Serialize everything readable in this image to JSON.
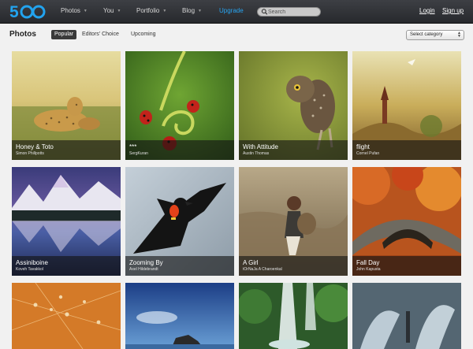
{
  "nav": {
    "logo_text": "500",
    "items": [
      {
        "label": "Photos"
      },
      {
        "label": "You"
      },
      {
        "label": "Portfolio"
      },
      {
        "label": "Blog"
      }
    ],
    "upgrade": "Upgrade",
    "search_placeholder": "Search",
    "login": "Login",
    "signup": "Sign up"
  },
  "subheader": {
    "title": "Photos",
    "tabs": [
      {
        "label": "Popular",
        "active": true
      },
      {
        "label": "Editors' Choice",
        "active": false
      },
      {
        "label": "Upcoming",
        "active": false
      }
    ],
    "category_select": "Select category"
  },
  "photos": [
    {
      "title": "Honey & Toto",
      "author": "Simon Phillpotts"
    },
    {
      "title": "***",
      "author": "SergKuran"
    },
    {
      "title": "With Attitude",
      "author": "Austin Thomas"
    },
    {
      "title": "flight",
      "author": "Cornel Pufan"
    },
    {
      "title": "Assiniboine",
      "author": "Koveh Tavakkol"
    },
    {
      "title": "Zooming By",
      "author": "Axel Hildebrandt"
    },
    {
      "title": "A Girl",
      "author": "tOrNaJa A Charoenkal"
    },
    {
      "title": "Fall Day",
      "author": "John Kapusta"
    },
    {
      "title": "",
      "author": ""
    },
    {
      "title": "",
      "author": ""
    },
    {
      "title": "",
      "author": ""
    },
    {
      "title": "",
      "author": ""
    }
  ],
  "colors": {
    "topbar": "#2f3135",
    "accent": "#27a4f0",
    "page_bg": "#f1f1f1"
  }
}
